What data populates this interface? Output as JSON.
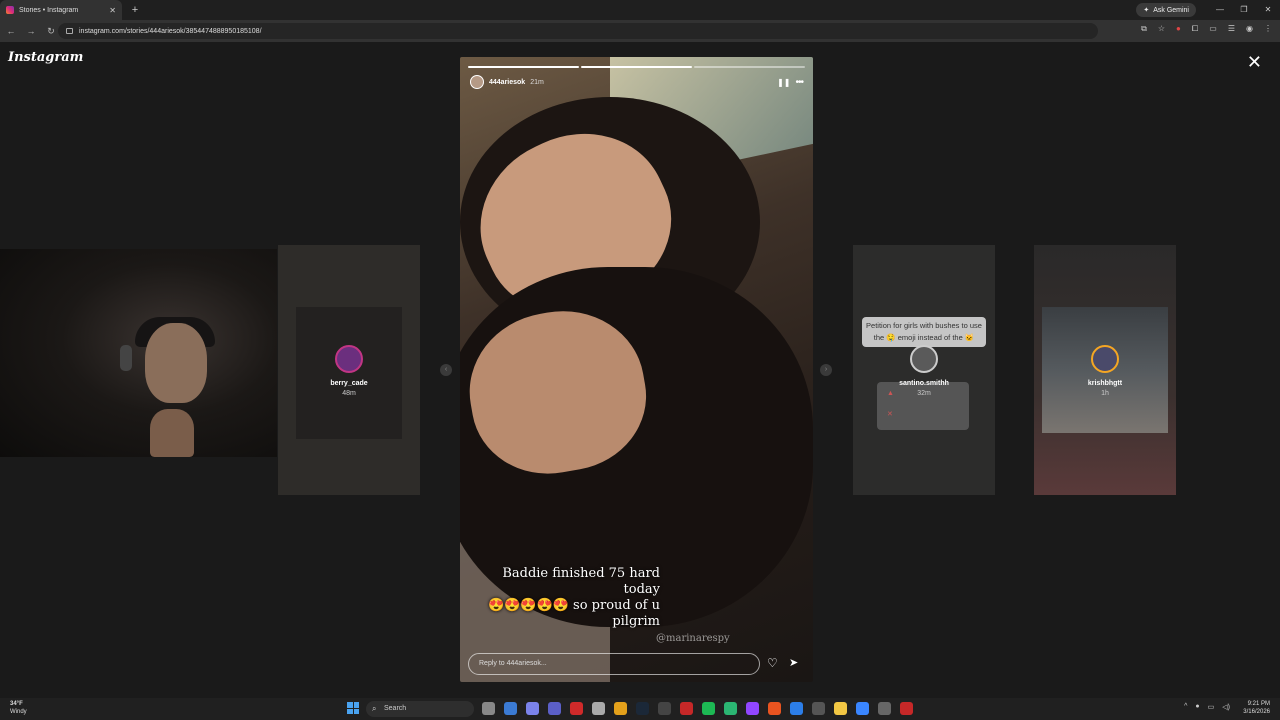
{
  "browser": {
    "tab_title": "Stories • Instagram",
    "tab_close": "✕",
    "new_tab": "+",
    "gemini_label": "Ask Gemini",
    "url": "instagram.com/stories/444ariesok/3854474888950185108/",
    "window_controls": [
      "—",
      "❐",
      "✕"
    ]
  },
  "page": {
    "logo": "Instagram",
    "close": "✕"
  },
  "side_stories": [
    {
      "username": "berry_cade",
      "time": "48m"
    },
    {
      "username": "santino.smithh",
      "time": "32m",
      "petition_text": "Petition for girls with bushes to use the 🤤 emoji instead of the 🐱"
    },
    {
      "username": "krishbhgtt",
      "time": "1h"
    }
  ],
  "story": {
    "username": "444ariesok",
    "time": "21m",
    "caption_line1": "Baddie finished 75 hard today",
    "caption_line2": "😍😍😍😍😍 so proud of u",
    "caption_line3": "pilgrim",
    "watermark": "@marinarespy",
    "reply_placeholder": "Reply to 444ariesok...",
    "progress_segments": 3,
    "progress_done": 2
  },
  "taskbar": {
    "temp": "34°F",
    "weather": "Windy",
    "search_label": "Search",
    "time": "9:21 PM",
    "date": "3/16/2026"
  }
}
